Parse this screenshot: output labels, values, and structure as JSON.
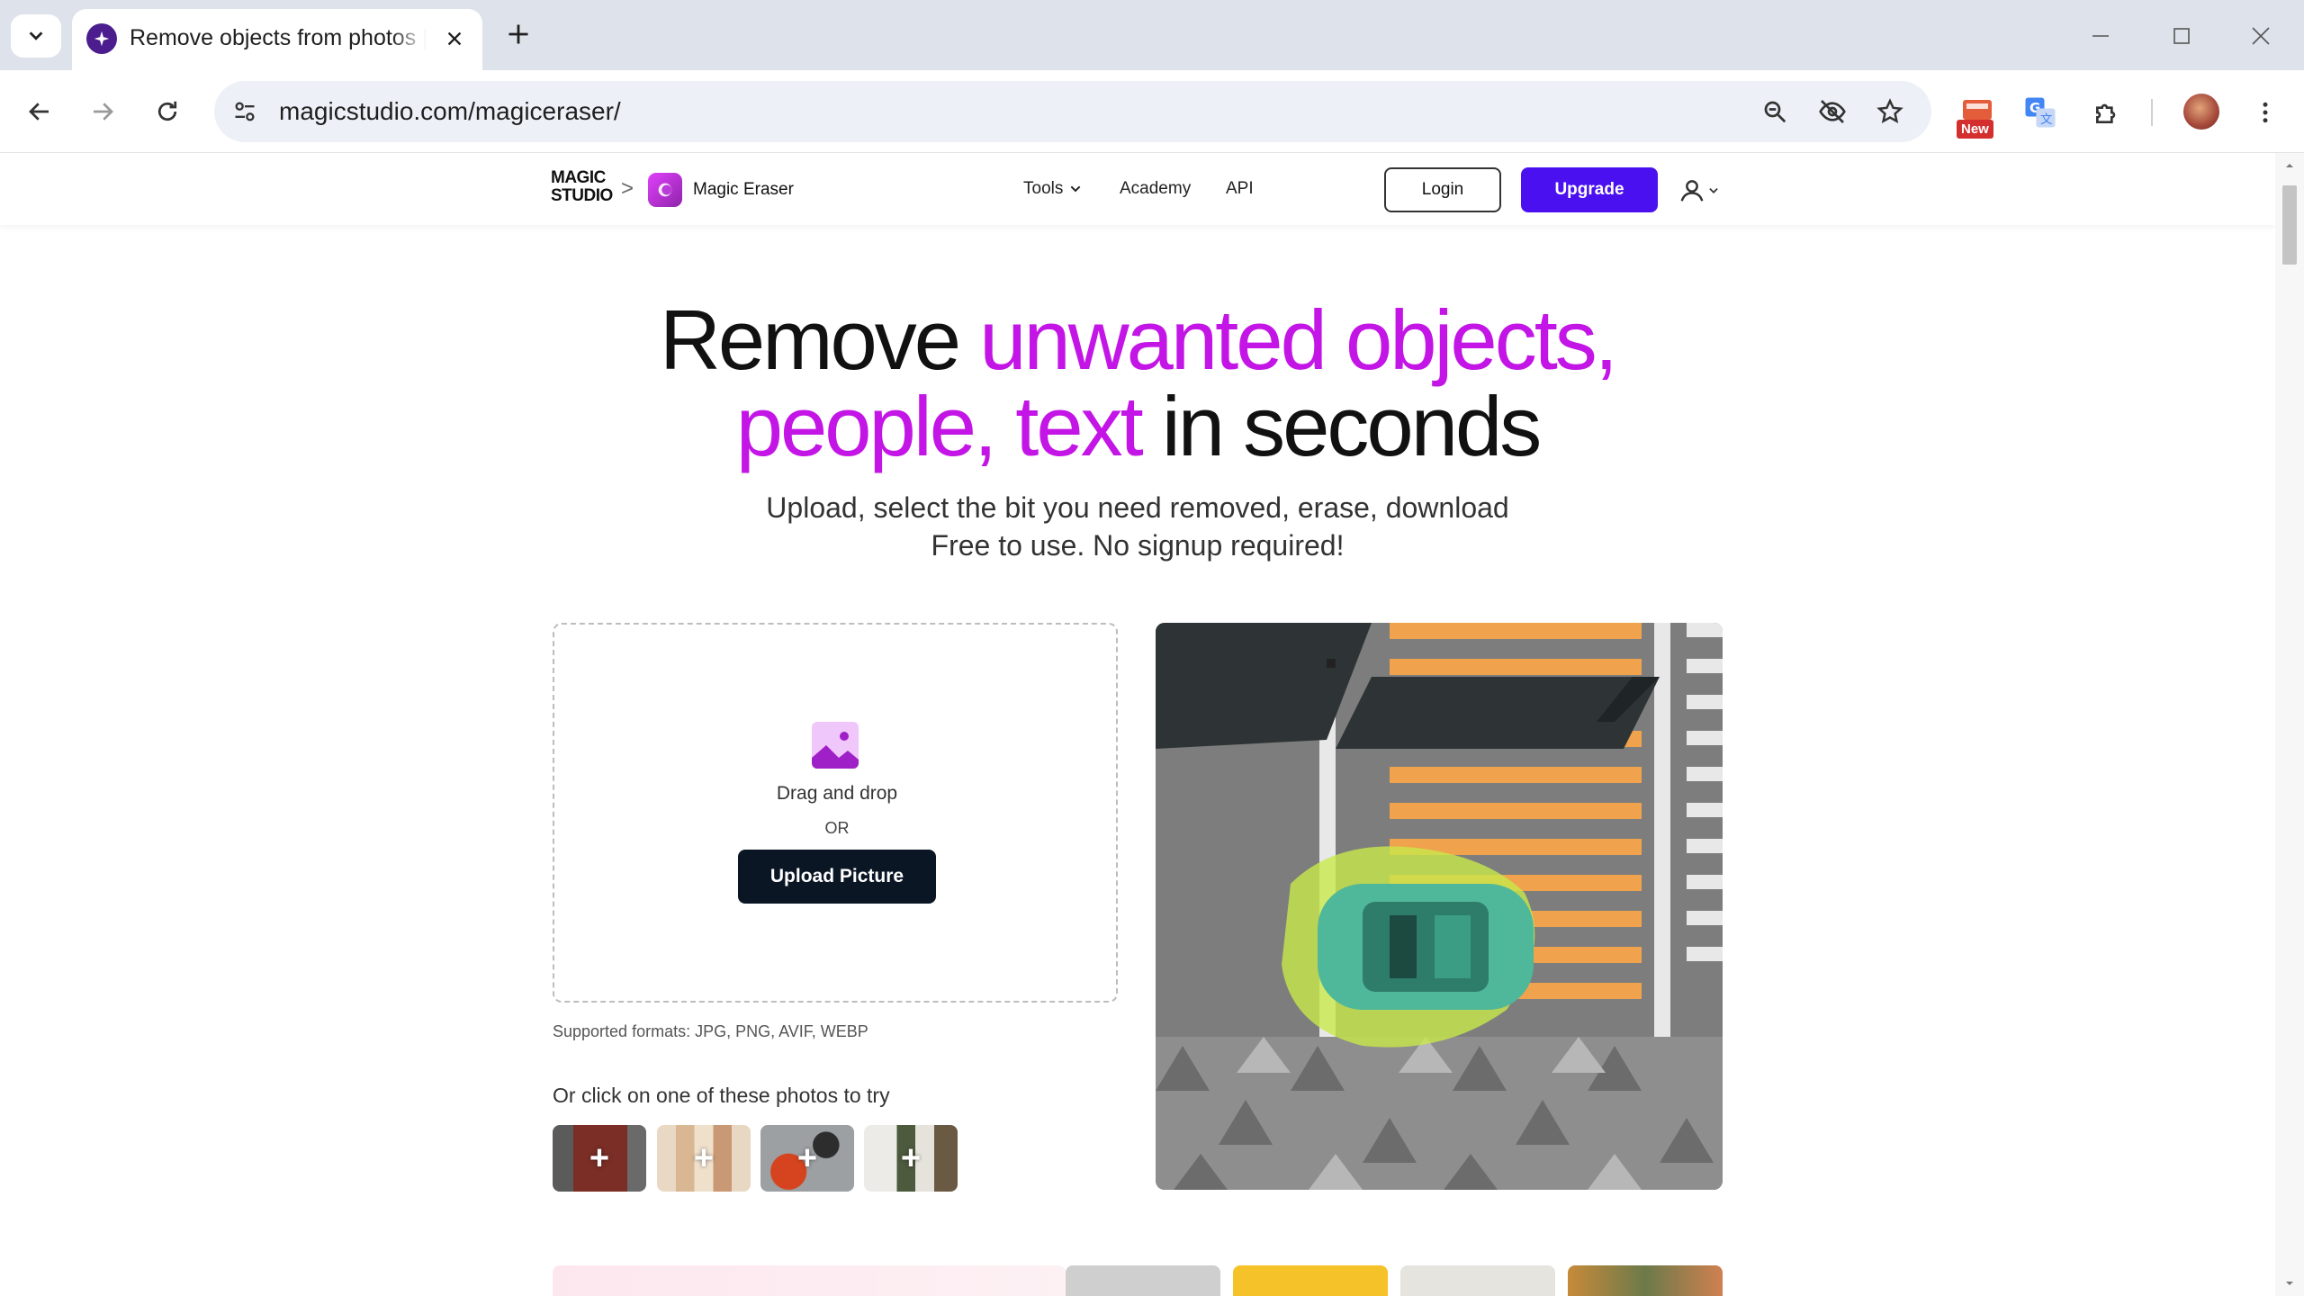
{
  "browser": {
    "tab_title": "Remove objects from photos | Magic Studio",
    "url": "magicstudio.com/magiceraser/",
    "extension_badge": "New"
  },
  "site": {
    "logo_line1": "MAGIC",
    "logo_line2": "STUDIO",
    "breadcrumb_sep": ">",
    "product_name": "Magic Eraser",
    "nav": {
      "tools": "Tools",
      "academy": "Academy",
      "api": "API"
    },
    "login": "Login",
    "upgrade": "Upgrade"
  },
  "hero": {
    "title_part1": "Remove ",
    "title_accent1": "unwanted objects,",
    "title_accent2": "people, text",
    "title_part2": " in seconds",
    "subtitle_line1": "Upload, select the bit you need removed, erase, download",
    "subtitle_line2": "Free to use. No signup required!"
  },
  "upload": {
    "drag_drop": "Drag and drop",
    "or": "OR",
    "button": "Upload Picture",
    "formats": "Supported formats: JPG, PNG, AVIF, WEBP",
    "try_label": "Or click on one of these photos to try",
    "sample_plus": "+"
  },
  "colors": {
    "accent_purple": "#c315e6",
    "upgrade_blue": "#4a10ef",
    "upload_button": "#0b1625"
  }
}
